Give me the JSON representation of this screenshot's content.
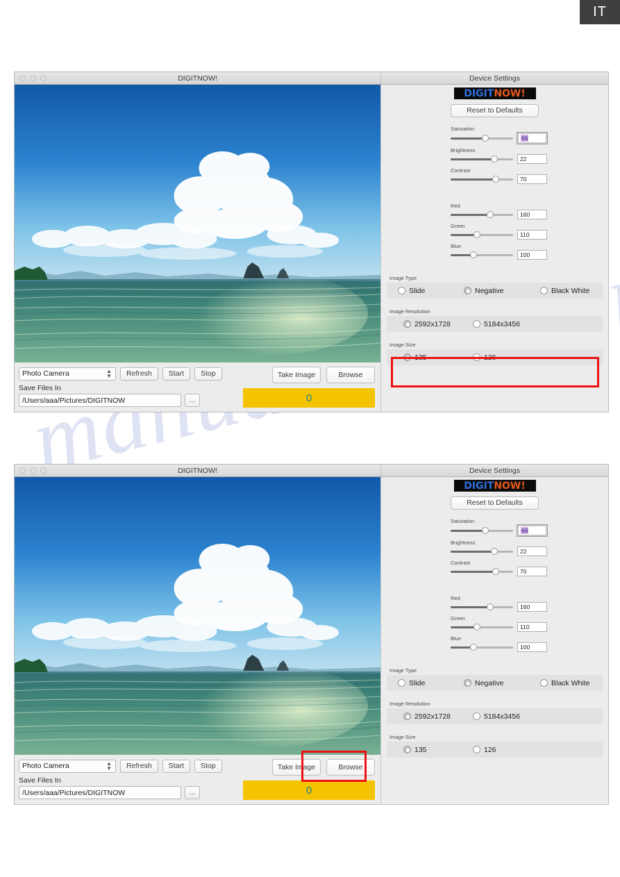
{
  "page": {
    "language_tab": "IT",
    "watermark": "manualshive.com"
  },
  "window": {
    "app_title": "DIGITNOW!",
    "settings_title": "Device Settings",
    "logo_part1": "DIGIT",
    "logo_part2": "NOW!"
  },
  "settings": {
    "reset_label": "Reset to Defaults",
    "sliders": [
      {
        "label": "Saturation",
        "value": "66",
        "percent": 55,
        "focused": true
      },
      {
        "label": "Brightness",
        "value": "22",
        "percent": 70,
        "focused": false
      },
      {
        "label": "Contrast",
        "value": "70",
        "percent": 72,
        "focused": false
      },
      {
        "label": "Red",
        "value": "160",
        "percent": 63,
        "focused": false
      },
      {
        "label": "Green",
        "value": "110",
        "percent": 42,
        "focused": false
      },
      {
        "label": "Blue",
        "value": "100",
        "percent": 37,
        "focused": false
      }
    ],
    "image_type": {
      "label": "Image Type",
      "options": [
        {
          "label": "Slide",
          "selected": false
        },
        {
          "label": "Negative",
          "selected": true
        },
        {
          "label": "Black White",
          "selected": false
        }
      ]
    },
    "image_resolution": {
      "label": "Image Resolution",
      "options": [
        {
          "label": "2592x1728",
          "selected": true
        },
        {
          "label": "5184x3456",
          "selected": false
        }
      ]
    },
    "image_size": {
      "label": "Image Size",
      "options": [
        {
          "label": "135",
          "selected": true
        },
        {
          "label": "126",
          "selected": false
        }
      ]
    }
  },
  "toolbar": {
    "device_select": "Photo Camera",
    "refresh_label": "Refresh",
    "start_label": "Start",
    "stop_label": "Stop",
    "take_image_label": "Take Image",
    "browse_label": "Browse",
    "save_files_label": "Save Files In",
    "save_path": "/Users/aaa/Pictures/DIGITNOW",
    "browse_dots_label": "...",
    "counter_value": "0"
  }
}
